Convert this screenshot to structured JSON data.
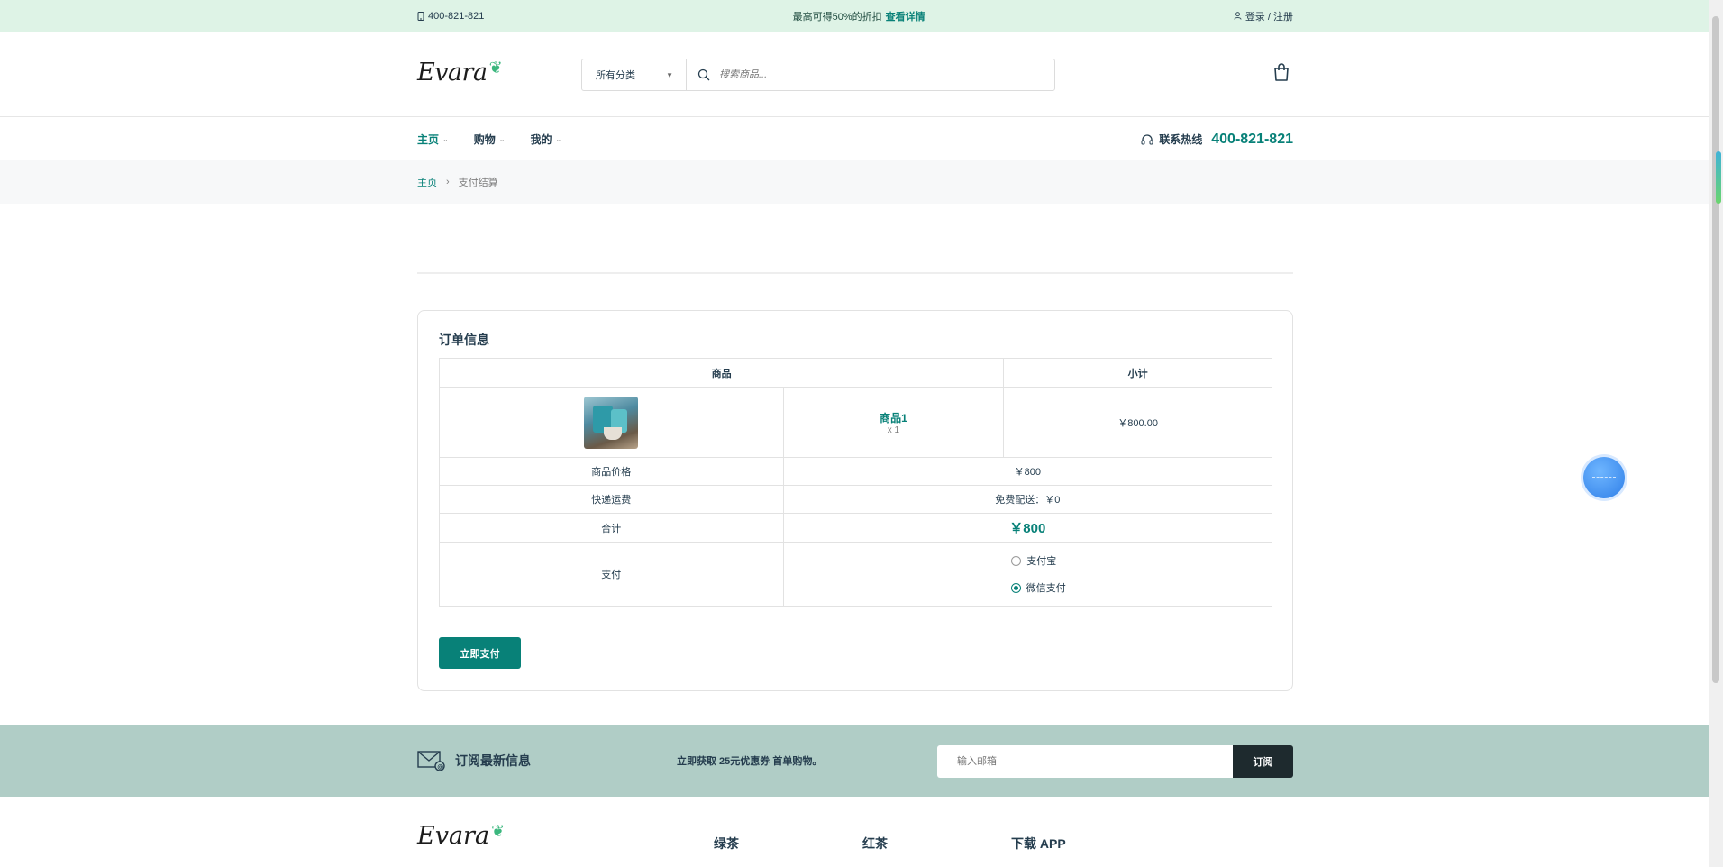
{
  "topbar": {
    "phone": "400-821-821",
    "promo_text": "最高可得50%的折扣",
    "promo_link": "查看详情",
    "login": "登录 / 注册"
  },
  "header": {
    "logo_text": "Evara",
    "search_category": "所有分类",
    "search_placeholder": "搜索商品..."
  },
  "nav": {
    "items": [
      {
        "label": "主页",
        "active": true
      },
      {
        "label": "购物",
        "active": false
      },
      {
        "label": "我的",
        "active": false
      }
    ],
    "hotline_label": "联系热线",
    "hotline_number": "400-821-821"
  },
  "breadcrumb": {
    "home": "主页",
    "separator": "›",
    "current": "支付结算"
  },
  "order": {
    "title": "订单信息",
    "col_product": "商品",
    "col_subtotal": "小计",
    "item": {
      "name": "商品1",
      "qty": "x 1",
      "subtotal": "￥800.00"
    },
    "price_label": "商品价格",
    "price_value": "￥800",
    "shipping_label": "快递运费",
    "shipping_value": "免费配送：￥0",
    "total_label": "合计",
    "total_value": "￥800",
    "payment_label": "支付",
    "payment_options": [
      {
        "label": "支付宝",
        "checked": false
      },
      {
        "label": "微信支付",
        "checked": true
      }
    ],
    "pay_button": "立即支付"
  },
  "newsletter": {
    "title": "订阅最新信息",
    "offer": "立即获取 25元优惠券 首单购物。",
    "email_placeholder": "输入邮箱",
    "subscribe_button": "订阅"
  },
  "footer": {
    "logo_text": "Evara",
    "columns": [
      "绿茶",
      "红茶",
      "下载 APP"
    ]
  },
  "colors": {
    "brand": "#088178",
    "topbar_bg": "#def3e6",
    "newsletter_bg": "#b0cdc6"
  }
}
